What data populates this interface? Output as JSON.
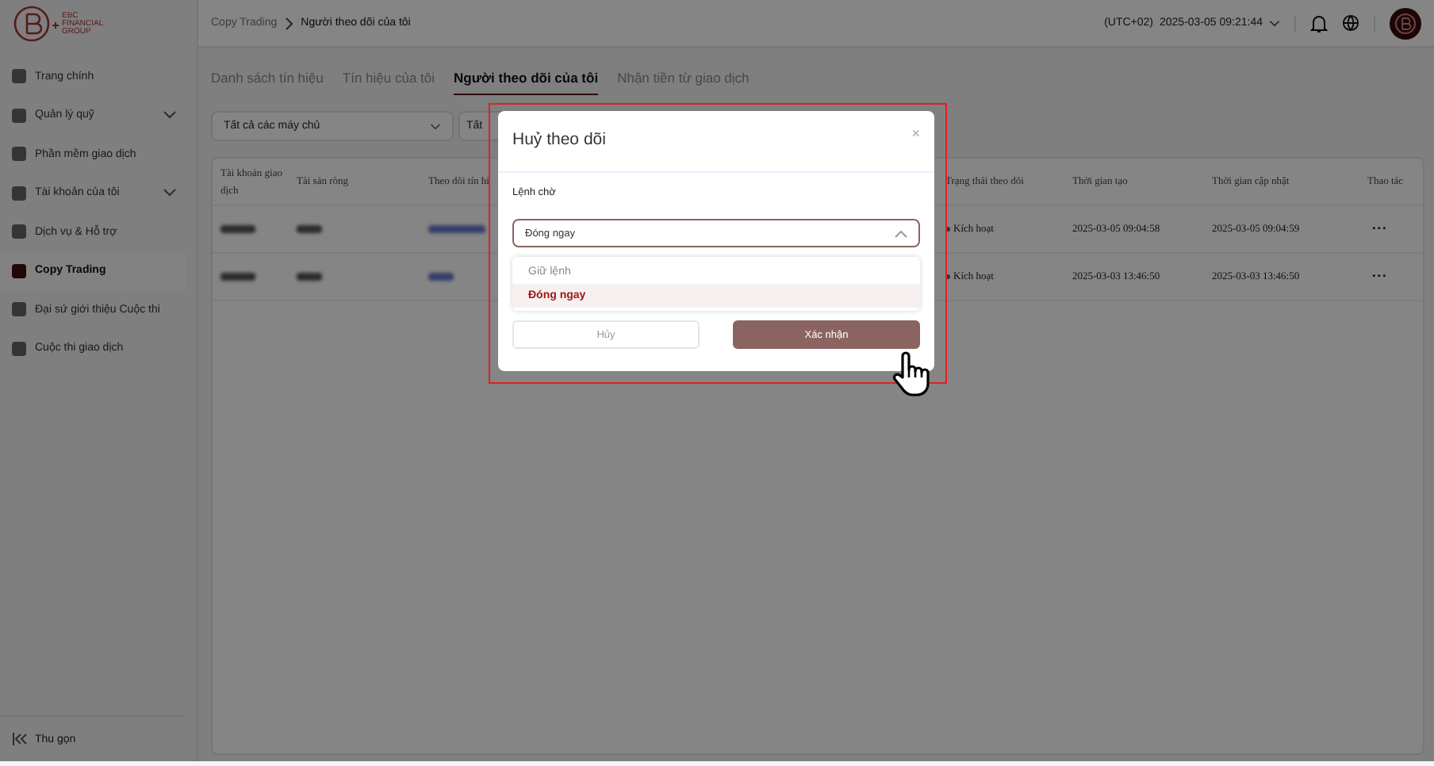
{
  "logo": {
    "lines": [
      "EBC",
      "FINANCIAL",
      "GROUP"
    ]
  },
  "sidebar": {
    "items": [
      {
        "label": "Trang chính",
        "kind": "link",
        "selected": false
      },
      {
        "label": "Quản lý quỹ",
        "kind": "group",
        "selected": false
      },
      {
        "label": "Phần mềm giao dịch",
        "kind": "link",
        "selected": false
      },
      {
        "label": "Tài khoản của tôi",
        "kind": "group",
        "selected": false
      },
      {
        "label": "Dịch vụ & Hỗ trợ",
        "kind": "link",
        "selected": false
      },
      {
        "label": "Copy Trading",
        "kind": "link",
        "selected": true
      },
      {
        "label": "Đại sứ giới thiệu Cuộc thi",
        "kind": "link",
        "selected": false
      },
      {
        "label": "Cuộc thi giao dịch",
        "kind": "link",
        "selected": false
      }
    ],
    "collapse": "Thu gọn"
  },
  "header": {
    "breadcrumb": [
      "Copy Trading",
      "Người theo dõi của tôi"
    ],
    "timezone": "(UTC+02)",
    "datetime": "2025-03-05 09:21:44"
  },
  "tabs": [
    {
      "label": "Danh sách tín hiệu",
      "selected": false
    },
    {
      "label": "Tín hiệu của tôi",
      "selected": false
    },
    {
      "label": "Người theo dõi của tôi",
      "selected": true
    },
    {
      "label": "Nhận tiền từ giao dịch",
      "selected": false
    }
  ],
  "filters": [
    "Tất cả các máy chủ",
    "Tất"
  ],
  "table": {
    "columns": [
      "Tài khoản giao dịch",
      "Tài sản ròng",
      "Theo dõi tín hi",
      "",
      "Trạng thái theo dõi",
      "Thời gian tạo",
      "Thời gian cập nhật",
      "Thao tác"
    ],
    "rows": [
      {
        "status": "Kích hoạt",
        "created": "2025-03-05 09:04:58",
        "updated": "2025-03-05 09:04:59",
        "action": "•••"
      },
      {
        "status": "Kích hoạt",
        "created": "2025-03-03 13:46:50",
        "updated": "2025-03-03 13:46:50",
        "action": "•••"
      }
    ]
  },
  "dialog": {
    "title": "Huỷ theo dõi",
    "close": "×",
    "field_label": "Lệnh chờ",
    "value": "Đóng ngay",
    "options": [
      {
        "label": "Giữ lệnh",
        "selected": false
      },
      {
        "label": "Đóng ngay",
        "selected": true
      }
    ],
    "buttons": [
      {
        "label": "Hủy",
        "kind": "secondary"
      },
      {
        "label": "Xác nhận",
        "kind": "primary"
      }
    ]
  }
}
